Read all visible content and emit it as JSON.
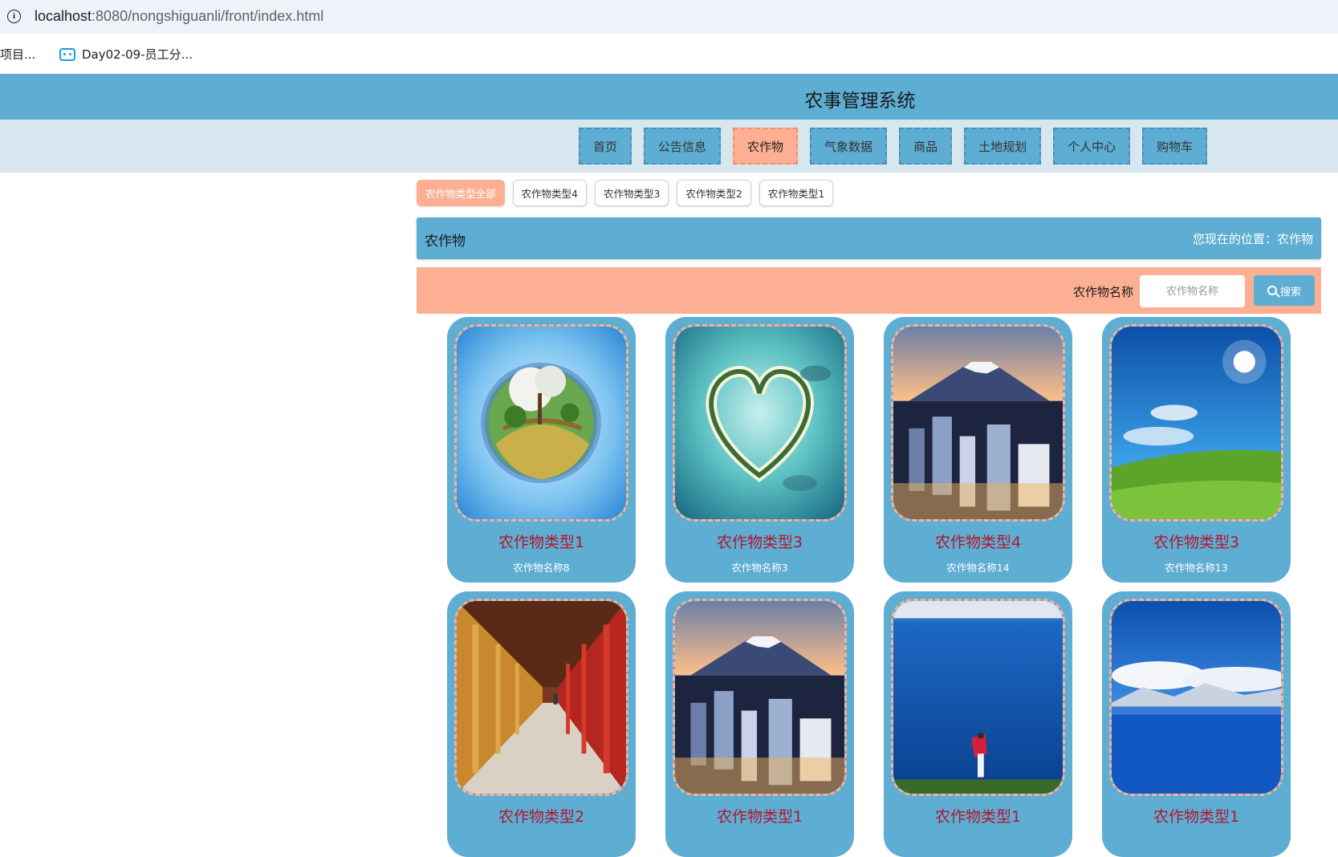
{
  "browser": {
    "url_host": "localhost",
    "url_rest": ":8080/nongshiguanli/front/index.html",
    "bookmarks": [
      {
        "label": "项目..."
      },
      {
        "label": "Day02-09-员工分..."
      }
    ]
  },
  "header": {
    "title": "农事管理系统"
  },
  "nav": {
    "items": [
      {
        "label": "首页"
      },
      {
        "label": "公告信息"
      },
      {
        "label": "农作物",
        "active": true
      },
      {
        "label": "气象数据"
      },
      {
        "label": "商品"
      },
      {
        "label": "土地规划"
      },
      {
        "label": "个人中心"
      },
      {
        "label": "购物车"
      }
    ]
  },
  "categories": [
    {
      "label": "农作物类型全部",
      "active": true
    },
    {
      "label": "农作物类型4"
    },
    {
      "label": "农作物类型3"
    },
    {
      "label": "农作物类型2"
    },
    {
      "label": "农作物类型1"
    }
  ],
  "breadcrumb": {
    "title": "农作物",
    "location": "您现在的位置：农作物"
  },
  "search": {
    "label": "农作物名称",
    "placeholder": "农作物名称",
    "button_label": "搜索"
  },
  "cards": [
    {
      "type": "农作物类型1",
      "name": "农作物名称8",
      "image": "tiny-planet"
    },
    {
      "type": "农作物类型3",
      "name": "农作物名称3",
      "image": "heart-island"
    },
    {
      "type": "农作物类型4",
      "name": "农作物名称14",
      "image": "mount-fuji-city"
    },
    {
      "type": "农作物类型3",
      "name": "农作物名称13",
      "image": "grass-hill-sky"
    },
    {
      "type": "农作物类型2",
      "name": "",
      "image": "temple-corridor"
    },
    {
      "type": "农作物类型1",
      "name": "",
      "image": "mount-fuji-city"
    },
    {
      "type": "农作物类型1",
      "name": "",
      "image": "blue-lake-woman"
    },
    {
      "type": "农作物类型1",
      "name": "",
      "image": "snow-mountain-lake"
    }
  ]
}
